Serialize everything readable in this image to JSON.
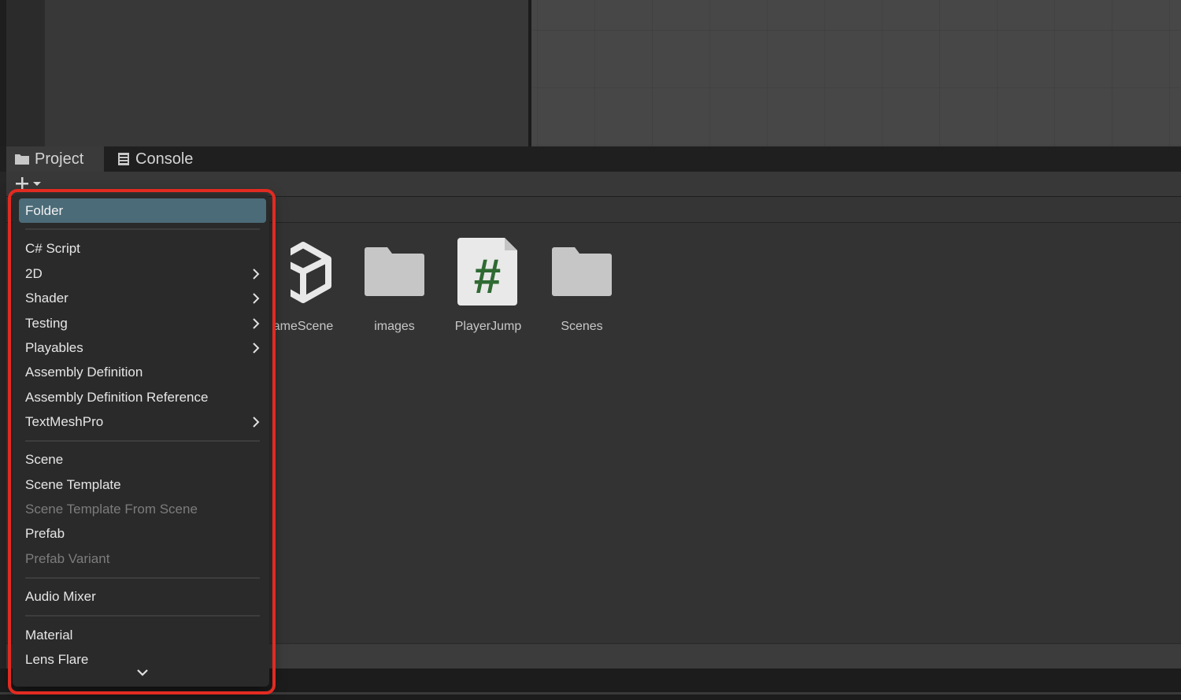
{
  "tabs": [
    {
      "label": "Project",
      "icon": "folder-icon"
    },
    {
      "label": "Console",
      "icon": "console-icon"
    }
  ],
  "toolbar": {
    "add_icon": "plus-icon",
    "dropdown_icon": "caret-down-icon"
  },
  "assets": [
    {
      "label": "ameScene",
      "icon": "unity-logo-icon"
    },
    {
      "label": "images",
      "icon": "folder-icon"
    },
    {
      "label": "PlayerJump",
      "icon": "csharp-script-icon",
      "glyph": "#"
    },
    {
      "label": "Scenes",
      "icon": "folder-icon"
    }
  ],
  "menu": {
    "items": [
      {
        "label": "Folder",
        "selected": true
      },
      {
        "label": "C# Script"
      },
      {
        "label": "2D",
        "submenu": true
      },
      {
        "label": "Shader",
        "submenu": true
      },
      {
        "label": "Testing",
        "submenu": true
      },
      {
        "label": "Playables",
        "submenu": true
      },
      {
        "label": "Assembly Definition"
      },
      {
        "label": "Assembly Definition Reference"
      },
      {
        "label": "TextMeshPro",
        "submenu": true
      },
      {
        "label": "Scene"
      },
      {
        "label": "Scene Template"
      },
      {
        "label": "Scene Template From Scene",
        "disabled": true
      },
      {
        "label": "Prefab"
      },
      {
        "label": "Prefab Variant",
        "disabled": true
      },
      {
        "label": "Audio Mixer"
      },
      {
        "label": "Material"
      },
      {
        "label": "Lens Flare"
      }
    ],
    "scroll_icon": "chevron-down-icon"
  },
  "colors": {
    "highlight": "#e12b21",
    "selected": "#4b6b78",
    "script_glyph": "#2f6a33"
  }
}
